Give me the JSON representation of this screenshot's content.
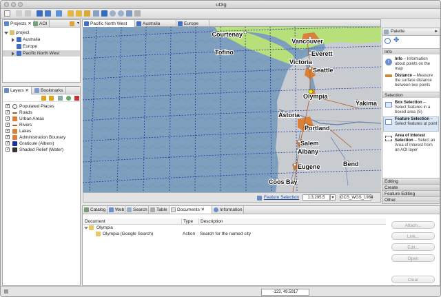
{
  "window": {
    "title": "uDig"
  },
  "projects": {
    "tabs": [
      "Projects",
      "AOI"
    ],
    "root": "project",
    "items": [
      "Australia",
      "Europe",
      "Pacific North West"
    ]
  },
  "layers": {
    "tabs": [
      "Layers",
      "Bookmarks"
    ],
    "items": [
      {
        "label": "Populated Places",
        "icon": "circle-icon"
      },
      {
        "label": "Roads",
        "icon": "line-icon"
      },
      {
        "label": "Urban Areas",
        "icon": "polygon-icon"
      },
      {
        "label": "Rivers",
        "icon": "line-icon"
      },
      {
        "label": "Lakes",
        "icon": "polygon-icon"
      },
      {
        "label": "Administration Bounary",
        "icon": "polygon-icon"
      },
      {
        "label": "Graticule (Albers)",
        "icon": "graticule-icon"
      },
      {
        "label": "Shaded Relief (Water)",
        "icon": "raster-icon"
      }
    ]
  },
  "editor_tabs": [
    "Pacific North West",
    "Australia",
    "Europe"
  ],
  "map": {
    "cities": [
      "Courtenay",
      "Vancouver",
      "Tofino",
      "Victoria",
      "Everett",
      "Seattle",
      "Olympia",
      "Yakima",
      "Astoria",
      "Portland",
      "Salem",
      "Albany",
      "Eugene",
      "Bend",
      "Coos Bay"
    ],
    "colors": {
      "water": "#7f9fbf",
      "land": "#c8ccd0",
      "canada": "#b7e07a",
      "urban": "#d9803a",
      "graticule": "#1f2f9f"
    }
  },
  "map_status": {
    "tool": "Feature Selection",
    "scale": "1:3,295,5",
    "crs": "GCS_WGS_1984"
  },
  "palette": {
    "title": "Palette",
    "sections": {
      "info": "Info",
      "selection": "Selection",
      "collapsed": [
        "Editing",
        "Create",
        "Feature Editing",
        "Other"
      ]
    },
    "info_items": [
      {
        "name": "Info",
        "desc": " – Information about points on the map"
      },
      {
        "name": "Distance",
        "desc": " – Measure the surface distance between two points"
      }
    ],
    "selection_items": [
      {
        "name": "Box Selection",
        "desc": " – Select features in a boxed area (S)"
      },
      {
        "name": "Feature Selection",
        "desc": " – Select features at point"
      },
      {
        "name": "Area of Interest Selection",
        "desc": " – Select an Area of Interest from an AOI layer"
      }
    ]
  },
  "bottom": {
    "tabs": [
      "Catalog",
      "Web",
      "Search",
      "Table",
      "Documents",
      "Information"
    ],
    "columns": [
      "Document",
      "Type",
      "Description"
    ],
    "rows": [
      {
        "document": "Olympia",
        "type": "",
        "description": ""
      },
      {
        "document": "Olympia (Google Search)",
        "type": "Action",
        "description": "Search for the named city"
      }
    ],
    "buttons": [
      "Attach...",
      "Link...",
      "Edit...",
      "Open",
      "Clear"
    ]
  },
  "statusbar": {
    "coords": "-123, 49.5917"
  }
}
